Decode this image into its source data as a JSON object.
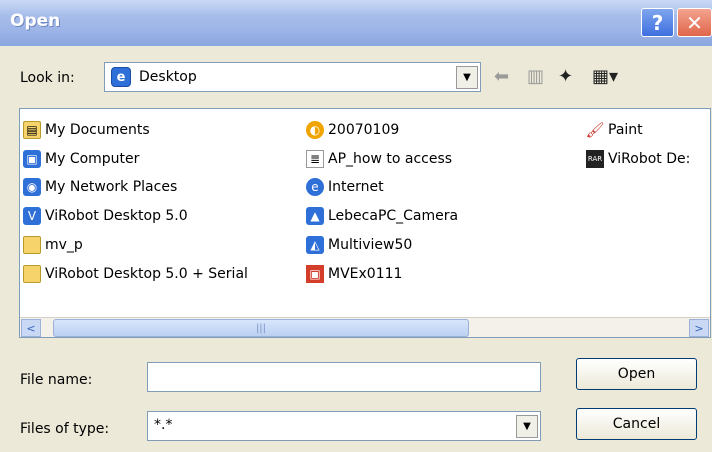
{
  "titlebar": {
    "title": "Open",
    "help": "?",
    "close": "✕"
  },
  "lookin": {
    "label": "Look in:",
    "value": "Desktop"
  },
  "items": [
    {
      "label": "My Documents",
      "icon": "folder-docs-icon"
    },
    {
      "label": "My Computer",
      "icon": "computer-icon"
    },
    {
      "label": "My Network Places",
      "icon": "network-icon"
    },
    {
      "label": "ViRobot Desktop 5.0",
      "icon": "virobot-shortcut-icon"
    },
    {
      "label": "mv_p",
      "icon": "folder-icon"
    },
    {
      "label": "ViRobot Desktop 5.0 + Serial",
      "icon": "folder-icon"
    },
    {
      "label": "20070109",
      "icon": "cd-folder-icon"
    },
    {
      "label": "AP_how to access",
      "icon": "text-file-icon"
    },
    {
      "label": "Internet",
      "icon": "internet-icon"
    },
    {
      "label": "LebecaPC_Camera",
      "icon": "camera-shortcut-icon"
    },
    {
      "label": "Multiview50",
      "icon": "multiview-shortcut-icon"
    },
    {
      "label": "MVEx0111",
      "icon": "mvex-icon"
    },
    {
      "label": "Paint",
      "icon": "paint-icon"
    },
    {
      "label": "ViRobot De:",
      "icon": "virobot-rar-icon"
    }
  ],
  "filename": {
    "label": "File name:",
    "value": ""
  },
  "filetype": {
    "label": "Files of type:",
    "value": "*.*"
  },
  "buttons": {
    "open": "Open",
    "cancel": "Cancel"
  }
}
